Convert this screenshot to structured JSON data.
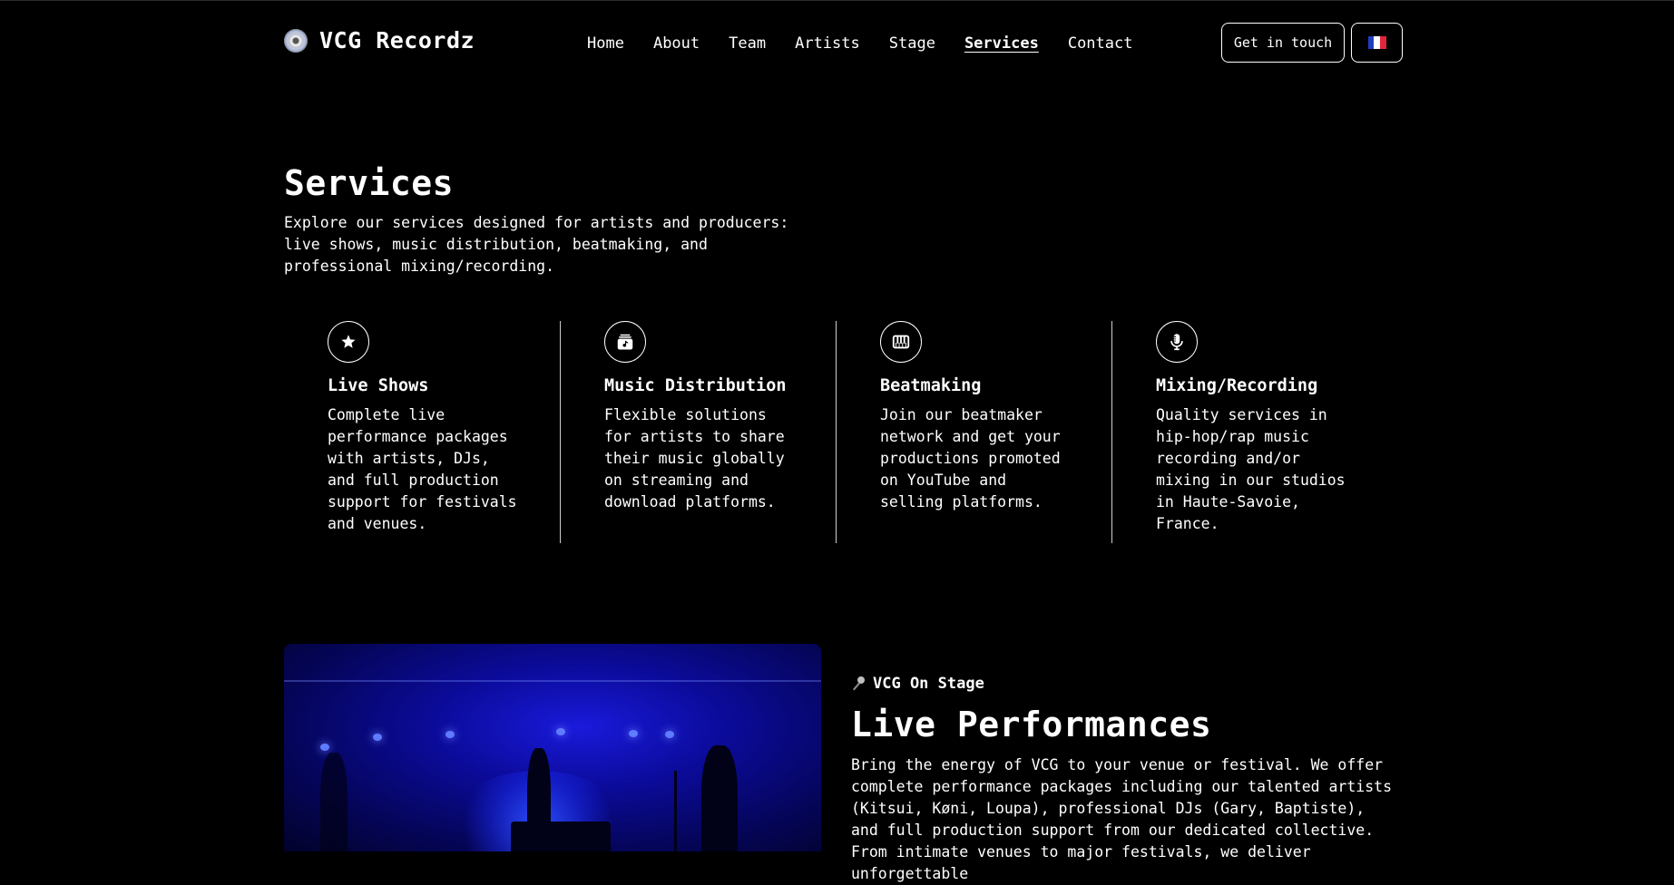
{
  "header": {
    "logo_text": "VCG Recordz",
    "logo_icon": "cd-disc-icon",
    "nav": [
      {
        "label": "Home",
        "active": false
      },
      {
        "label": "About",
        "active": false
      },
      {
        "label": "Team",
        "active": false
      },
      {
        "label": "Artists",
        "active": false
      },
      {
        "label": "Stage",
        "active": false
      },
      {
        "label": "Services",
        "active": true
      },
      {
        "label": "Contact",
        "active": false
      }
    ],
    "cta_label": "Get in touch",
    "language_flag": "french-flag-icon"
  },
  "services": {
    "title": "Services",
    "description": "Explore our services designed for artists and producers: live shows, music distribution, beatmaking, and professional mixing/recording.",
    "items": [
      {
        "icon": "star-icon",
        "title": "Live Shows",
        "text": "Complete live performance packages with artists, DJs, and full production support for festivals and venues."
      },
      {
        "icon": "music-album-icon",
        "title": "Music Distribution",
        "text": "Flexible solutions for artists to share their music globally on streaming and download platforms."
      },
      {
        "icon": "piano-keys-icon",
        "title": "Beatmaking",
        "text": "Join our beatmaker network and get your productions promoted on YouTube and selling platforms."
      },
      {
        "icon": "microphone-icon",
        "title": "Mixing/Recording",
        "text": "Quality services in hip-hop/rap music recording and/or mixing in our studios in Haute-Savoie, France."
      }
    ]
  },
  "stage": {
    "tag": "VCG On Stage",
    "tag_icon": "microphone-icon",
    "title": "Live Performances",
    "description": "Bring the energy of VCG to your venue or festival. We offer complete performance packages including our talented artists (Kitsui, Køni, Loupa), professional DJs (Gary, Baptiste), and full production support from our dedicated collective. From intimate venues to major festivals, we deliver unforgettable"
  },
  "colors": {
    "background": "#000000",
    "text": "#ffffff",
    "stage_blue": "#1a1adb"
  }
}
